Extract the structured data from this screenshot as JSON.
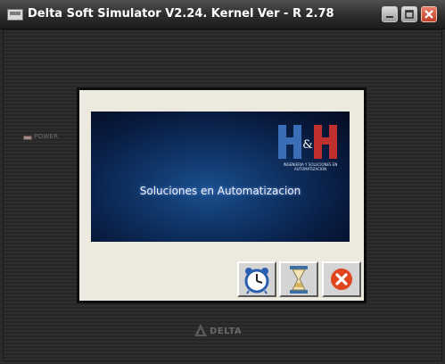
{
  "window": {
    "title": "Delta Soft Simulator V2.24. Kernel Ver - R 2.78",
    "controls": [
      "minimize-icon",
      "maximize-icon",
      "close-icon"
    ]
  },
  "device": {
    "power_label": "POWER",
    "brand_label": "DELTA",
    "brand_icon": "delta-triangle-icon"
  },
  "screen": {
    "splash_text": "Soluciones en Automatizacion",
    "logo_text": "H&H",
    "logo_subtitle": "INGENIERIA Y SOLUCIONES EN AUTOMATIZACION",
    "colors": {
      "logo_blue": "#3a6fb8",
      "logo_red": "#c0302e",
      "splash_dark": "#081a3e"
    }
  },
  "buttons": [
    {
      "icon": "alarm-clock-icon"
    },
    {
      "icon": "hourglass-icon"
    },
    {
      "icon": "cancel-icon",
      "color": "#e0451e"
    }
  ]
}
